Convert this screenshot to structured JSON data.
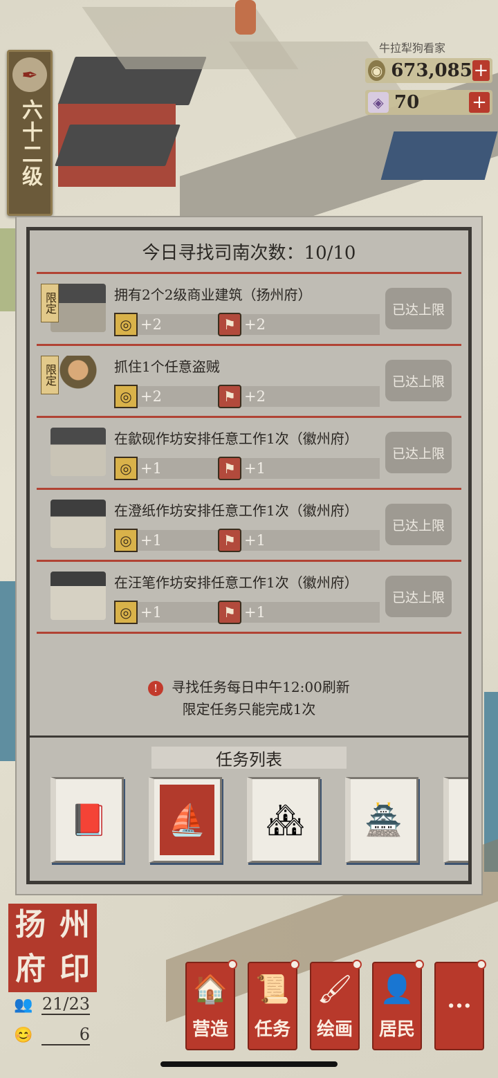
{
  "top": {
    "level_text": "六十二级",
    "currency_hint": "牛拉犁狗看家",
    "coins": "673,085",
    "gems": "70",
    "plus": "+"
  },
  "panel": {
    "title": "今日寻找司南次数：10/10",
    "limited_tag": "限定",
    "max_label": "已达上限",
    "tasks": [
      {
        "name": "拥有2个2级商业建筑（扬州府）",
        "reward1": "+2",
        "reward2": "+2",
        "limited": true
      },
      {
        "name": "抓住1个任意盗贼",
        "reward1": "+2",
        "reward2": "+2",
        "limited": true
      },
      {
        "name": "在歙砚作坊安排任意工作1次（徽州府）",
        "reward1": "+1",
        "reward2": "+1",
        "limited": false
      },
      {
        "name": "在澄纸作坊安排任意工作1次（徽州府）",
        "reward1": "+1",
        "reward2": "+1",
        "limited": false
      },
      {
        "name": "在汪笔作坊安排任意工作1次（徽州府）",
        "reward1": "+1",
        "reward2": "+1",
        "limited": false
      }
    ],
    "notice_line1": "寻找任务每日中午12:00刷新",
    "notice_line2": "限定任务只能完成1次",
    "list_title": "任务列表"
  },
  "seal": {
    "chars": [
      "扬",
      "州",
      "府",
      "印"
    ],
    "population": "21/23",
    "happiness": "6"
  },
  "bottom_nav": [
    {
      "label": "营造",
      "icon": "🏠"
    },
    {
      "label": "任务",
      "icon": "📜"
    },
    {
      "label": "绘画",
      "icon": "🖌"
    },
    {
      "label": "居民",
      "icon": "👤"
    },
    {
      "label": "···",
      "icon": ""
    }
  ]
}
